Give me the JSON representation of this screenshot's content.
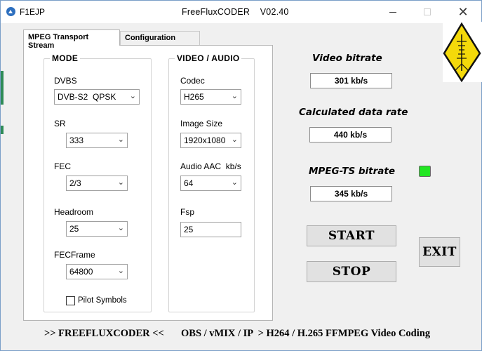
{
  "titlebar": {
    "left_title": "F1EJP",
    "center_title": "FreeFluxCODER    V02.40",
    "buttons": {
      "minimize": "minimize",
      "maximize": "maximize",
      "close": "✕"
    }
  },
  "tabs": [
    {
      "label": "MPEG Transport Stream",
      "active": true
    },
    {
      "label": "Configuration",
      "active": false
    }
  ],
  "mode": {
    "legend": "MODE",
    "dvbs": {
      "label": "DVBS",
      "value": "DVB-S2  QPSK"
    },
    "sr": {
      "label": "SR",
      "value": "333"
    },
    "fec": {
      "label": "FEC",
      "value": "2/3"
    },
    "headroom": {
      "label": "Headroom",
      "value": "25"
    },
    "fecframe": {
      "label": "FECFrame",
      "value": "64800"
    },
    "pilot": {
      "label": "Pilot Symbols",
      "checked": false
    }
  },
  "video_audio": {
    "legend": "VIDEO / AUDIO",
    "codec": {
      "label": "Codec",
      "value": "H265"
    },
    "image_size": {
      "label": "Image Size",
      "value": "1920x1080"
    },
    "audio": {
      "label": "Audio AAC  kb/s",
      "value": "64"
    },
    "fsp": {
      "label": "Fsp",
      "value": "25"
    }
  },
  "status": {
    "video_bitrate": {
      "label": "Video bitrate",
      "value": "301 kb/s"
    },
    "calc_rate": {
      "label": "Calculated data rate",
      "value": "440 kb/s"
    },
    "ts_bitrate": {
      "label": "MPEG-TS bitrate",
      "value": "345 kb/s"
    },
    "led_color": "#22e622"
  },
  "buttons": {
    "start": "START",
    "stop": "STOP",
    "exit": "EXIT"
  },
  "footer": {
    "left": ">> FREEFLUXCODER <<",
    "right": "OBS / vMIX / IP  > H264 / H.265 FFMPEG Video Coding"
  },
  "colors": {
    "accent_blue": "#2d6fbf",
    "logo_yellow": "#f4d90a"
  },
  "icons": {
    "chevron": "chevron-down-icon",
    "logo": "f1ejp-antenna-logo"
  }
}
